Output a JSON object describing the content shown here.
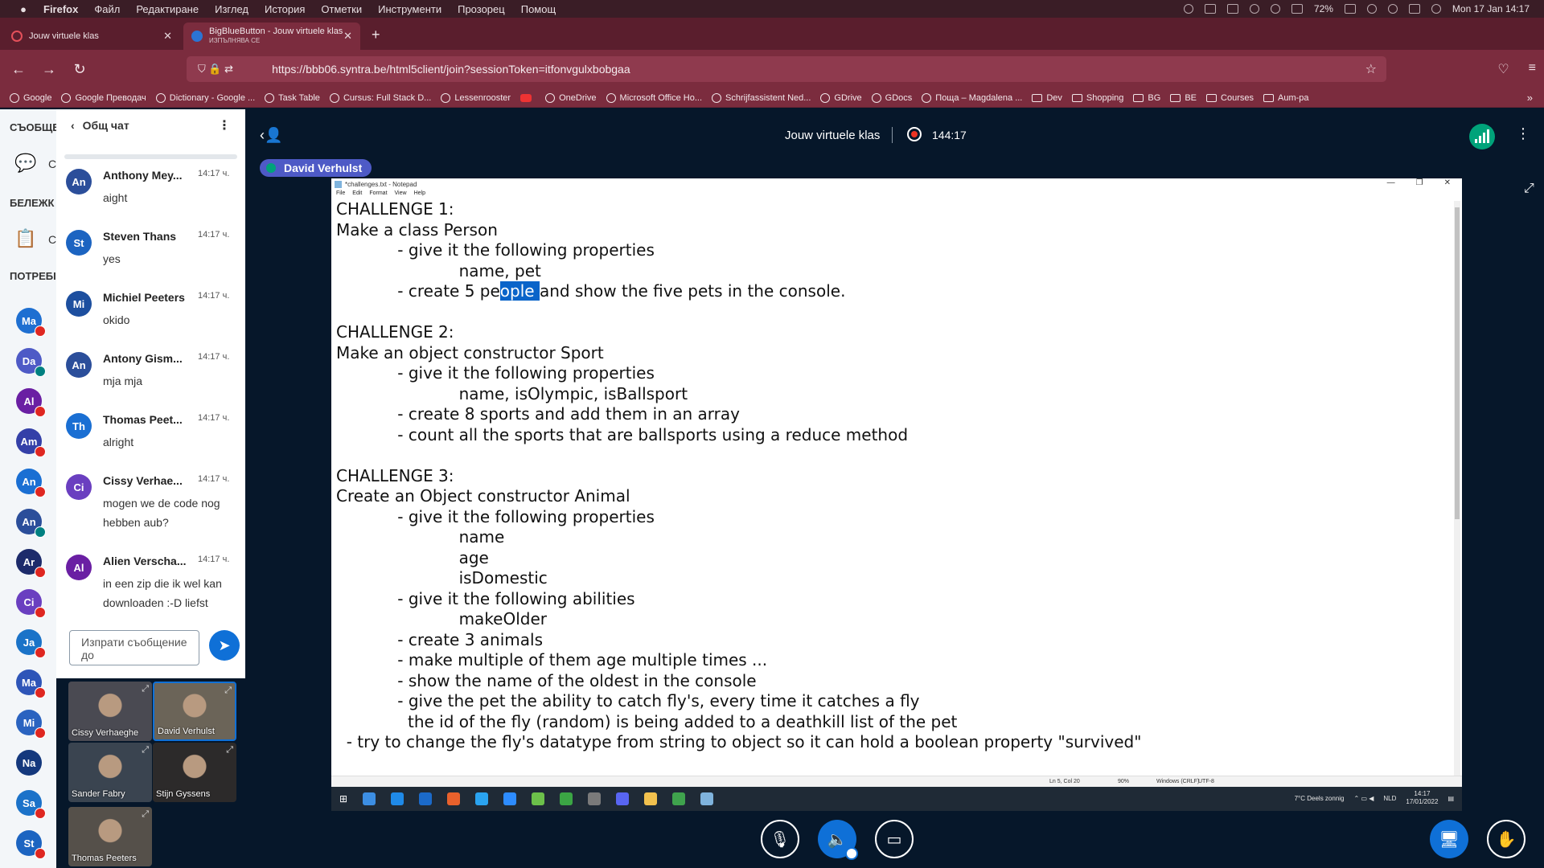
{
  "mac_menubar": {
    "app": "Firefox",
    "items": [
      "Файл",
      "Редактиране",
      "Изглед",
      "История",
      "Отметки",
      "Инструменти",
      "Прозорец",
      "Помощ"
    ],
    "battery": "72%",
    "datetime": "Mon 17 Jan  14:17"
  },
  "tabs": [
    {
      "title": "Jouw virtuele klas",
      "subtitle": ""
    },
    {
      "title": "BigBlueButton - Jouw virtuele klas",
      "subtitle": "ИЗПЪЛНЯВА СЕ"
    }
  ],
  "url": "https://bbb06.syntra.be/html5client/join?sessionToken=itfonvgulxbobgaa",
  "bookmarks": [
    "Google",
    "Google Преводач",
    "Dictionary - Google ...",
    "Task Table",
    "Cursus: Full Stack D...",
    "Lessenrooster",
    "",
    "OneDrive",
    "Microsoft Office Ho...",
    "Schrijfassistent Ned...",
    "GDrive",
    "GDocs",
    "Поща – Magdalena ...",
    "Dev",
    "Shopping",
    "BG",
    "BE",
    "Courses",
    "Aum-pa"
  ],
  "usercol": {
    "messages_label": "СЪОБЩЕ",
    "notes_label": "БЕЛЕЖК",
    "users_label": "ПОТРЕБІ",
    "clip_messages": "С",
    "clip_notes": "С",
    "users": [
      {
        "initials": "Ma",
        "color": "#1e6fd1",
        "badge": "red"
      },
      {
        "initials": "Da",
        "color": "#4e5ac6",
        "badge": "green"
      },
      {
        "initials": "Al",
        "color": "#6a1fa3",
        "badge": "red"
      },
      {
        "initials": "Am",
        "color": "#3440a8",
        "badge": "red"
      },
      {
        "initials": "An",
        "color": "#1a6fd3",
        "badge": "red"
      },
      {
        "initials": "An",
        "color": "#2b4e9a",
        "badge": "green"
      },
      {
        "initials": "Ar",
        "color": "#1d2b6b",
        "badge": "red"
      },
      {
        "initials": "Ci",
        "color": "#6a3fc0",
        "badge": "red"
      },
      {
        "initials": "Ja",
        "color": "#1a73c8",
        "badge": "red"
      },
      {
        "initials": "Ma",
        "color": "#2e55b8",
        "badge": "red"
      },
      {
        "initials": "Mi",
        "color": "#2a63c0",
        "badge": "red"
      },
      {
        "initials": "Na",
        "color": "#14387d",
        "badge": ""
      },
      {
        "initials": "Sa",
        "color": "#1b72c9",
        "badge": "red"
      },
      {
        "initials": "St",
        "color": "#1c64c1",
        "badge": "red"
      }
    ]
  },
  "chat": {
    "title": "Общ чат",
    "input_placeholder": "Изпрати съобщение до",
    "messages": [
      {
        "initials": "An",
        "color": "#2b4e9a",
        "name": "Anthony Mey...",
        "time": "14:17 ч.",
        "text": "aight"
      },
      {
        "initials": "St",
        "color": "#1c64c1",
        "name": "Steven Thans",
        "time": "14:17 ч.",
        "text": "yes"
      },
      {
        "initials": "Mi",
        "color": "#1d4f9f",
        "name": "Michiel Peeters",
        "time": "14:17 ч.",
        "text": "okido"
      },
      {
        "initials": "An",
        "color": "#2b4e9a",
        "name": "Antony Gism...",
        "time": "14:17 ч.",
        "text": "mja mja"
      },
      {
        "initials": "Th",
        "color": "#1a6fd3",
        "name": "Thomas Peet...",
        "time": "14:17 ч.",
        "text": "alright"
      },
      {
        "initials": "Ci",
        "color": "#6a3fc0",
        "name": "Cissy Verhae...",
        "time": "14:17 ч.",
        "text": "mogen we de code nog hebben aub?"
      },
      {
        "initials": "Al",
        "color": "#6a1fa3",
        "name": "Alien Verscha...",
        "time": "14:17 ч.",
        "text": "in een zip die ik wel kan downloaden :-D liefst"
      }
    ]
  },
  "webcams": [
    {
      "name": "Cissy Verhaeghe",
      "bg": "#4a4a52",
      "talking": false
    },
    {
      "name": "David Verhulst",
      "bg": "#6b6458",
      "talking": true
    },
    {
      "name": "Sander Fabry",
      "bg": "#3a4450",
      "talking": false
    },
    {
      "name": "Stijn Gyssens",
      "bg": "#2c2a2a",
      "talking": false
    },
    {
      "name": "Thomas Peeters",
      "bg": "#55504a",
      "talking": false
    }
  ],
  "meeting": {
    "title": "Jouw virtuele klas",
    "recording_time": "144:17",
    "talker": "David Verhulst"
  },
  "notepad": {
    "title": "*challenges.txt - Notepad",
    "menu": [
      "File",
      "Edit",
      "Format",
      "View",
      "Help"
    ],
    "lines": [
      "CHALLENGE 1:",
      "Make a class Person",
      "            - give it the following properties",
      "                        name, pet",
      "            - create 5 pe|ople |and show the five pets in the console.",
      "",
      "CHALLENGE 2:",
      "Make an object constructor Sport",
      "            - give it the following properties",
      "                        name, isOlympic, isBallsport",
      "            - create 8 sports and add them in an array",
      "            - count all the sports that are ballsports using a reduce method",
      "",
      "CHALLENGE 3:",
      "Create an Object constructor Animal",
      "            - give it the following properties",
      "                        name",
      "                        age",
      "                        isDomestic",
      "            - give it the following abilities",
      "                        makeOlder",
      "            - create 3 animals",
      "            - make multiple of them age multiple times ...",
      "            - show the name of the oldest in the console",
      "            - give the pet the ability to catch fly's, every time it catches a fly",
      "              the id of the fly (random) is being added to a deathkill list of the pet",
      "  - try to change the fly's datatype from string to object so it can hold a boolean property \"survived\""
    ],
    "status": {
      "pos": "Ln 5, Col 20",
      "zoom": "90%",
      "eol": "Windows (CRLF)",
      "enc": "UTF-8"
    }
  },
  "taskbar": {
    "icons": [
      "#3c8ee3",
      "#1f8ae8",
      "#1b6ac9",
      "#e8612c",
      "#2aa3f0",
      "#2d8cff",
      "#6cc04a",
      "#3ba544",
      "#7a7a7a",
      "#5865f2",
      "#f2c14e",
      "#3fa34d",
      "#7fb3dd"
    ],
    "weather": "7°C  Deels zonnig",
    "lang": "NLD",
    "time": "14:17",
    "date": "17/01/2022"
  }
}
